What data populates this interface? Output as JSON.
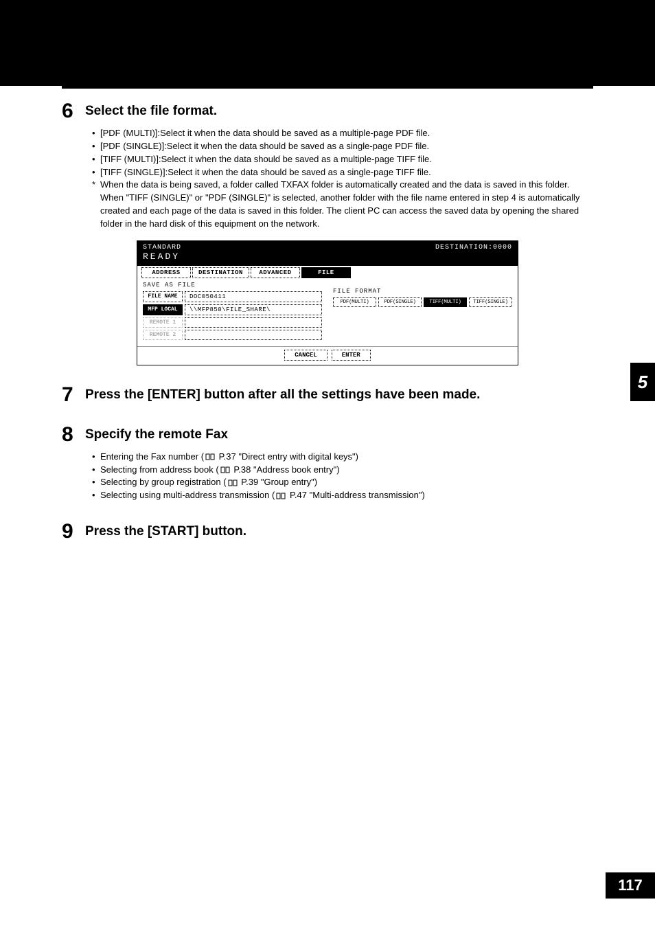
{
  "chapter_tab": "5",
  "page_number": "117",
  "steps": {
    "s6": {
      "num": "6",
      "title": "Select the file format.",
      "bullets": [
        "[PDF (MULTI)]:Select it when the data should be saved as a multiple-page PDF file.",
        "[PDF (SINGLE)]:Select it when the data should be saved as a single-page PDF file.",
        "[TIFF (MULTI)]:Select it when the data should be saved as a multiple-page TIFF file.",
        "[TIFF (SINGLE)]:Select it when the data should be saved as a single-page TIFF file."
      ],
      "footnote": "When the data is being saved, a folder called TXFAX folder is automatically created and the data is saved in this folder. When \"TIFF (SINGLE)\" or \"PDF (SINGLE)\" is selected, another folder with the file name entered in step 4 is automatically created and each page of the data is saved in this folder. The client PC can access the saved data by opening the shared folder in the hard disk of this equipment on the network."
    },
    "s7": {
      "num": "7",
      "title": "Press the [ENTER] button after all the settings have been made."
    },
    "s8": {
      "num": "8",
      "title": "Specify the remote Fax",
      "bullets_prefix": [
        "Entering the Fax number (",
        "Selecting from address book (",
        "Selecting by group registration (",
        "Selecting using multi-address transmission ("
      ],
      "bullets_refs": [
        " P.37 \"Direct entry with digital keys\")",
        " P.38 \"Address book entry\")",
        " P.39 \"Group entry\")",
        " P.47 \"Multi-address transmission\")"
      ]
    },
    "s9": {
      "num": "9",
      "title": "Press the [START] button."
    }
  },
  "screen": {
    "standard": "STANDARD",
    "ready": "READY",
    "destination": "DESTINATION:0000",
    "tabs": {
      "address": "ADDRESS",
      "destination": "DESTINATION",
      "advanced": "ADVANCED",
      "file": "FILE"
    },
    "save_as_file": "SAVE AS FILE",
    "file_name_label": "FILE NAME",
    "file_name_value": "DOC050411",
    "mfp_local_label": "MFP LOCAL",
    "mfp_local_value": "\\\\MFP850\\FILE_SHARE\\",
    "remote1": "REMOTE 1",
    "remote2": "REMOTE 2",
    "file_format": "FILE FORMAT",
    "formats": {
      "pdf_multi": "PDF(MULTI)",
      "pdf_single": "PDF(SINGLE)",
      "tiff_multi": "TIFF(MULTI)",
      "tiff_single": "TIFF(SINGLE)"
    },
    "cancel": "CANCEL",
    "enter": "ENTER"
  }
}
